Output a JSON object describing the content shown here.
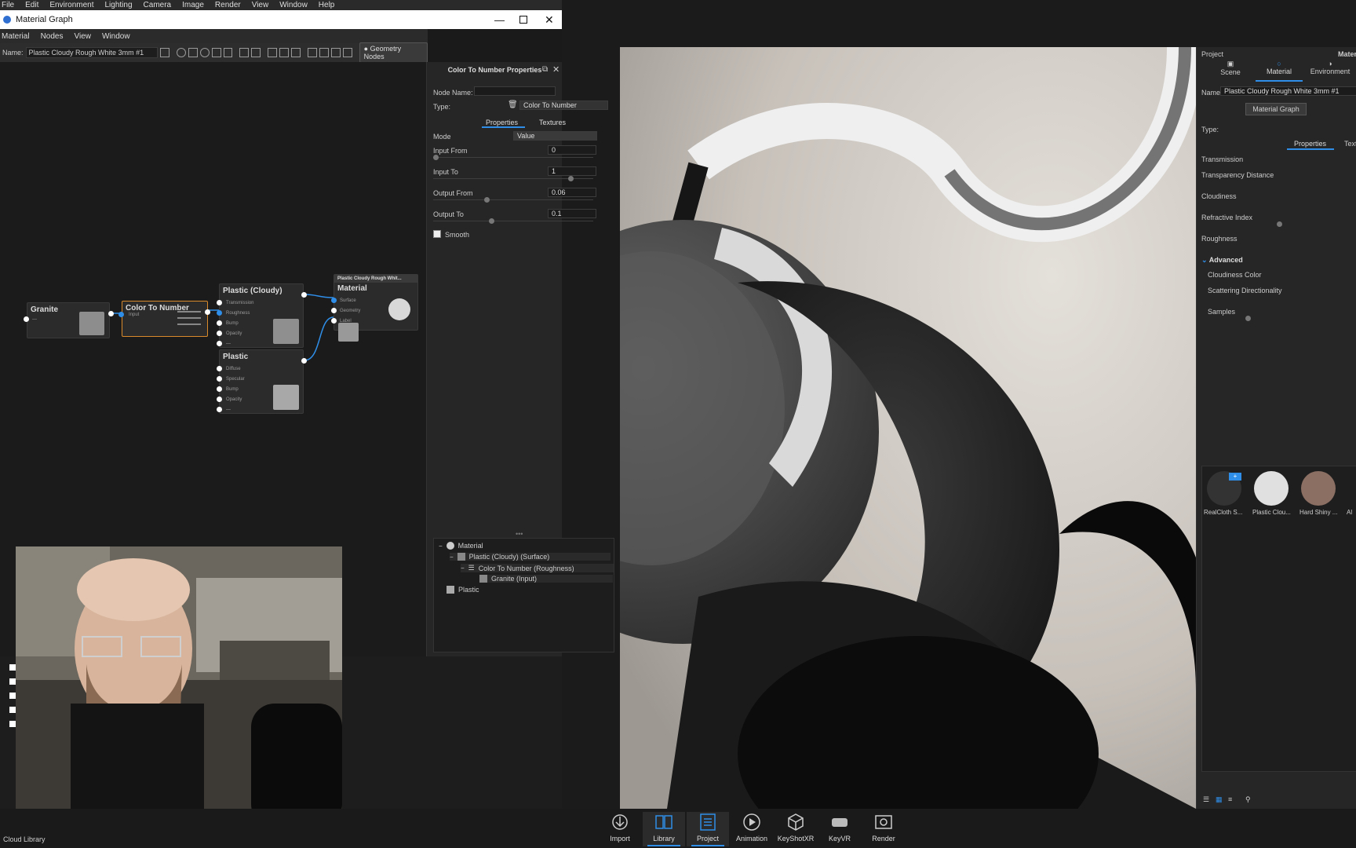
{
  "menubar": [
    "File",
    "Edit",
    "Environment",
    "Lighting",
    "Camera",
    "Image",
    "Render",
    "View",
    "Window",
    "Help"
  ],
  "mg_window": {
    "title": "Material Graph",
    "menu": [
      "Material",
      "Nodes",
      "View",
      "Window"
    ],
    "name_label": "Name:",
    "name_value": "Plastic Cloudy Rough White 3mm #1",
    "geometry_nodes": "Geometry Nodes"
  },
  "nodes": {
    "granite": {
      "title": "Granite",
      "port": "—"
    },
    "color_to_number": {
      "title": "Color To Number",
      "port": "Input"
    },
    "plastic_cloudy": {
      "title": "Plastic (Cloudy)",
      "ports": [
        "Transmission",
        "Roughness",
        "Bump",
        "Opacity",
        "—"
      ]
    },
    "plastic": {
      "title": "Plastic",
      "ports": [
        "Diffuse",
        "Specular",
        "Bump",
        "Opacity",
        "—"
      ]
    },
    "material": {
      "header": "Plastic Cloudy Rough Whit...",
      "title": "Material",
      "ports": [
        "Surface",
        "Geometry",
        "Label"
      ]
    }
  },
  "props": {
    "title": "Color To Number Properties",
    "node_name_label": "Node Name:",
    "node_name_value": "",
    "type_label": "Type:",
    "type_value": "Color To Number",
    "tabs": [
      "Properties",
      "Textures"
    ],
    "mode_label": "Mode",
    "mode_value": "Value",
    "fields": [
      {
        "label": "Input From",
        "value": "0",
        "slider": 0.0
      },
      {
        "label": "Input To",
        "value": "1",
        "slider": 0.88
      },
      {
        "label": "Output From",
        "value": "0.06",
        "slider": 0.33
      },
      {
        "label": "Output To",
        "value": "0.1",
        "slider": 0.36
      }
    ],
    "smooth_label": "Smooth",
    "tree": [
      {
        "label": "Material",
        "level": 0
      },
      {
        "label": "Plastic (Cloudy) (Surface)",
        "level": 1
      },
      {
        "label": "Color To Number (Roughness)",
        "level": 2
      },
      {
        "label": "Granite (Input)",
        "level": 3
      },
      {
        "label": "Plastic",
        "level": 0
      }
    ]
  },
  "right_panel": {
    "project_label": "Project",
    "material_cut": "Materi",
    "tabs": [
      "Scene",
      "Material",
      "Environment"
    ],
    "name_label": "Name:",
    "name_value": "Plastic Cloudy Rough White 3mm #1",
    "material_graph_btn": "Material Graph",
    "type_label": "Type:",
    "sub_tabs": [
      "Properties",
      "Textu"
    ],
    "params": [
      "Transmission",
      "Transparency Distance",
      "Cloudiness",
      "Refractive Index",
      "Roughness"
    ],
    "advanced_label": "Advanced",
    "advanced_params": [
      "Cloudiness Color",
      "Scattering Directionality",
      "Samples"
    ],
    "thumbnails": [
      "RealCloth S...",
      "Plastic Clou...",
      "Hard Shiny ...",
      "Al"
    ]
  },
  "bottom": {
    "cloud_library": "Cloud Library",
    "buttons": [
      "Import",
      "Library",
      "Project",
      "Animation",
      "KeyShotXR",
      "KeyVR",
      "Render"
    ]
  },
  "colors": {
    "accent": "#2f8ee8",
    "window_bg": "#1b1b1b",
    "panel_bg": "#262626"
  }
}
